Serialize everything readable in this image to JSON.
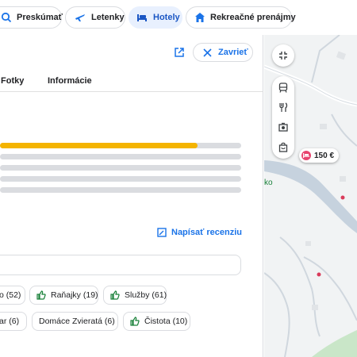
{
  "top_nav": {
    "chips": [
      {
        "label": "Preskúmať",
        "icon": "explore-icon"
      },
      {
        "label": "Letenky",
        "icon": "flight-icon"
      },
      {
        "label": "Hotely",
        "icon": "hotel-bed-icon",
        "active": true
      },
      {
        "label": "Rekreačné prenájmy",
        "icon": "home-icon"
      }
    ]
  },
  "panel": {
    "close_label": "Zavrieť",
    "tabs": [
      "Fotky",
      "Informácie"
    ],
    "rating_bars": [
      0.82,
      0,
      0,
      0,
      0
    ],
    "write_review_label": "Napísať recenziu",
    "search_placeholder": "",
    "tags_row1": [
      "o (52)",
      "Raňajky (19)",
      "Služby (61)"
    ],
    "tags_row2": [
      "ar (6)",
      "Domáce Zvieratá (6)",
      "Čistota (10)"
    ]
  },
  "map": {
    "price_pin_label": "150 €",
    "place_label_fragment": "ko",
    "tools": [
      "transit-icon",
      "restaurant-icon",
      "museum-icon",
      "shopping-bag-icon"
    ]
  },
  "colors": {
    "accent_blue": "#1a73e8",
    "rating_fill": "#f4b400",
    "active_chip_bg": "#e8f0fe",
    "pin_red": "#e8446f"
  }
}
